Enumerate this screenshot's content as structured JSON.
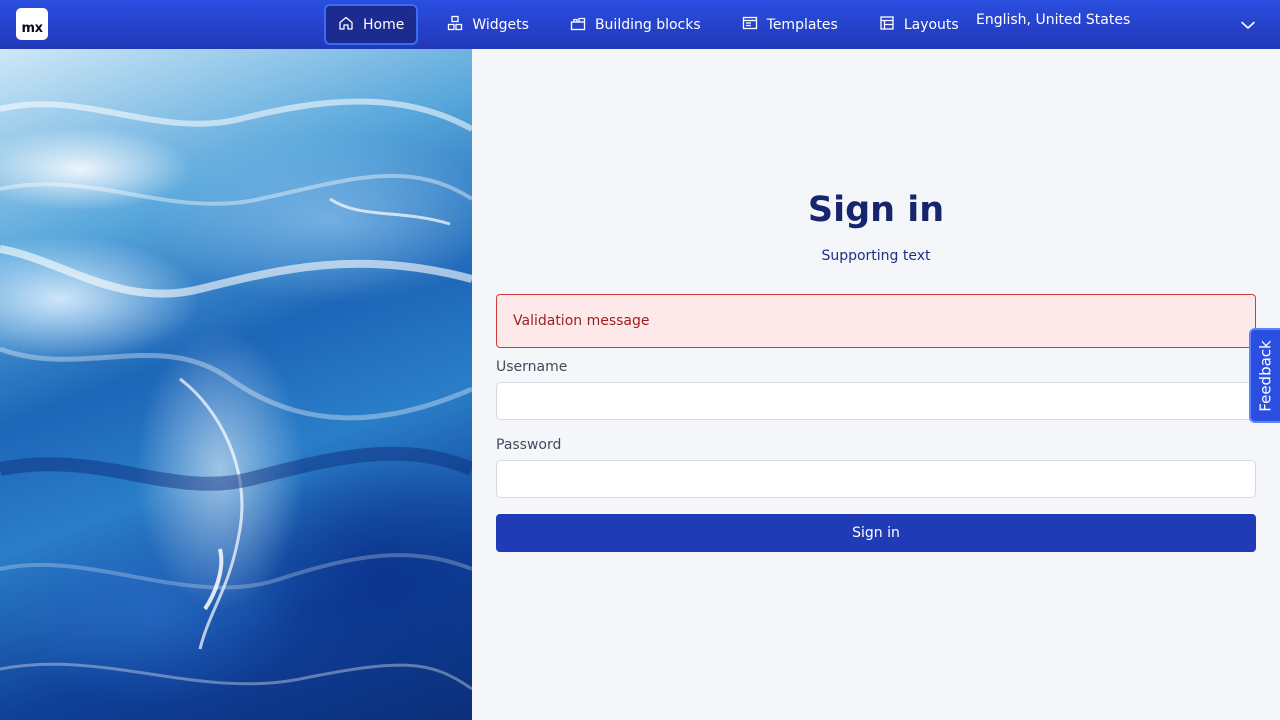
{
  "header": {
    "logo_text": "mx",
    "nav": [
      {
        "label": "Home",
        "icon": "home-icon",
        "active": true
      },
      {
        "label": "Widgets",
        "icon": "widgets-icon",
        "active": false
      },
      {
        "label": "Building blocks",
        "icon": "building-blocks-icon",
        "active": false
      },
      {
        "label": "Templates",
        "icon": "templates-icon",
        "active": false
      },
      {
        "label": "Layouts",
        "icon": "layouts-icon",
        "active": false
      }
    ],
    "language": "English, United States"
  },
  "hero": {
    "description_icon": "ocean-waves-image"
  },
  "form": {
    "title": "Sign in",
    "subtitle": "Supporting text",
    "validation_message": "Validation message",
    "username_label": "Username",
    "username_value": "",
    "password_label": "Password",
    "password_value": "",
    "submit_label": "Sign in"
  },
  "feedback": {
    "label": "Feedback"
  },
  "colors": {
    "header": "#2a4ee0",
    "active_nav": "#1c2b8f",
    "primary_button": "#1f3bb6",
    "title": "#16256e",
    "alert_bg": "#fde9ea",
    "alert_border": "#d33b3b",
    "alert_text": "#9c1f1f"
  }
}
